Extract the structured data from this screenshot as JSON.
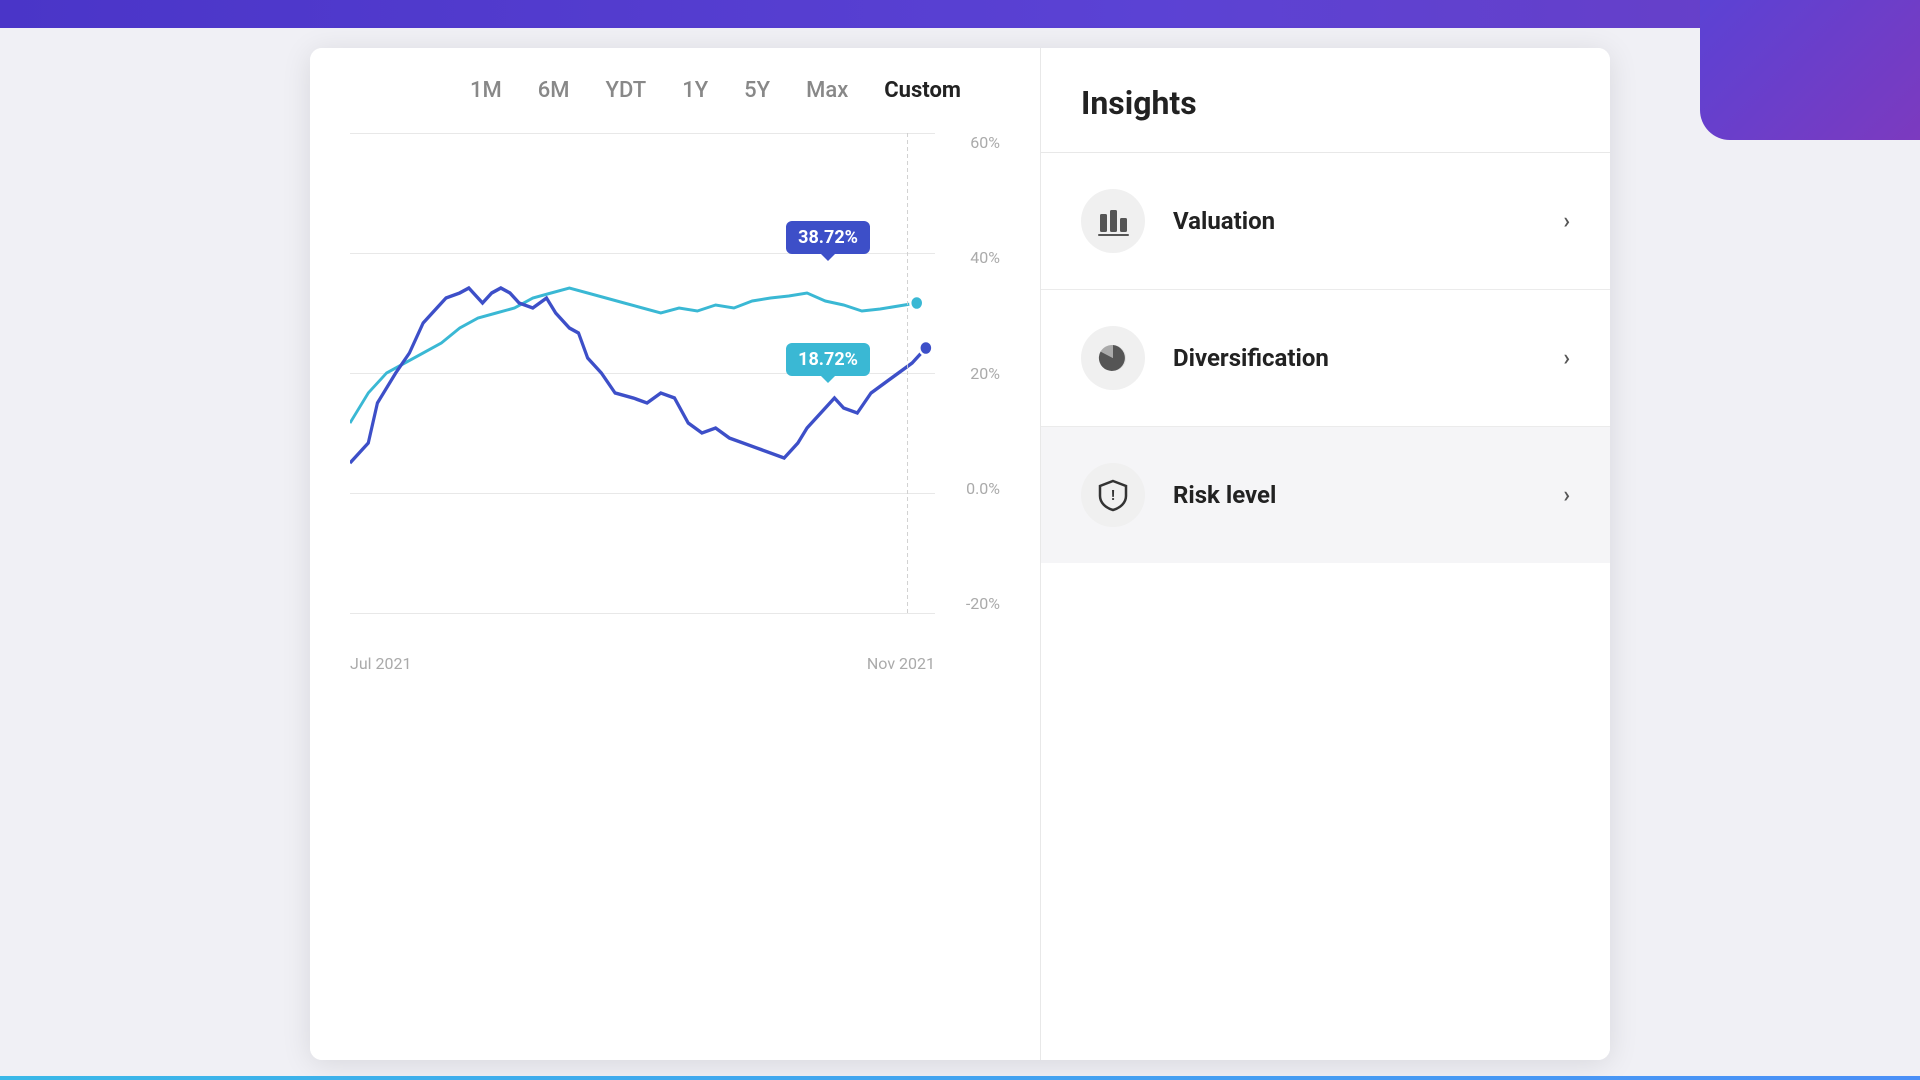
{
  "topBar": {},
  "chart": {
    "timeFilters": [
      {
        "label": "1M",
        "active": false
      },
      {
        "label": "6M",
        "active": false
      },
      {
        "label": "YDT",
        "active": false
      },
      {
        "label": "1Y",
        "active": false
      },
      {
        "label": "5Y",
        "active": false
      },
      {
        "label": "Max",
        "active": false
      },
      {
        "label": "Custom",
        "active": true
      }
    ],
    "yLabels": [
      "60%",
      "40%",
      "20%",
      "0.0%",
      "-20%"
    ],
    "xLabels": [
      "Jul 2021",
      "Nov 2021"
    ],
    "tooltipDark": "38.72%",
    "tooltipCyan": "18.72%",
    "colors": {
      "darkLine": "#3d4fc8",
      "cyanLine": "#3ab8d4",
      "dot": "#3d4fc8"
    }
  },
  "insights": {
    "title": "Insights",
    "items": [
      {
        "id": "valuation",
        "label": "Valuation",
        "icon": "bar-chart-icon",
        "active": false
      },
      {
        "id": "diversification",
        "label": "Diversification",
        "icon": "pie-chart-icon",
        "active": false
      },
      {
        "id": "risk-level",
        "label": "Risk level",
        "icon": "shield-icon",
        "active": true
      }
    ]
  }
}
